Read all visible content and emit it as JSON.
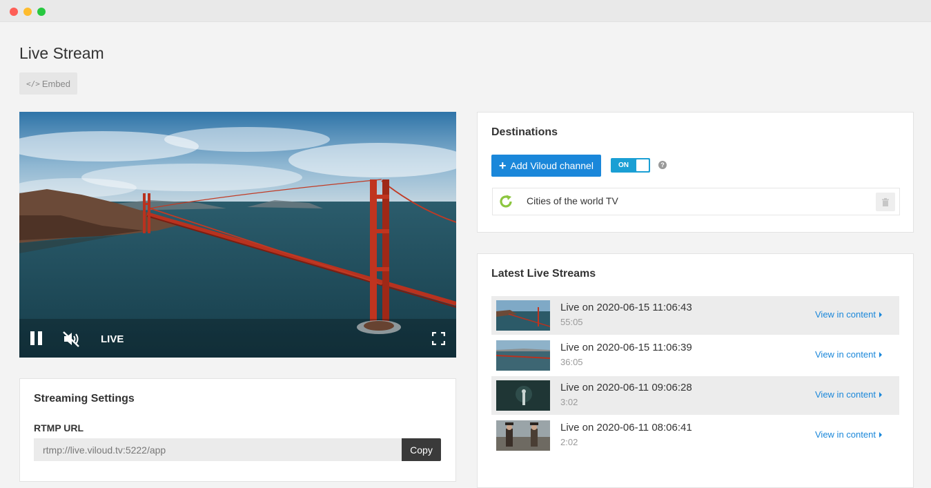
{
  "page": {
    "title": "Live Stream",
    "embed_label": "Embed"
  },
  "player": {
    "live_label": "LIVE",
    "state": "playing",
    "muted": true
  },
  "streaming_settings": {
    "title": "Streaming Settings",
    "rtmp_label": "RTMP URL",
    "rtmp_value": "rtmp://live.viloud.tv:5222/app",
    "copy_label": "Copy"
  },
  "destinations": {
    "title": "Destinations",
    "add_label": "Add Viloud channel",
    "toggle_label": "ON",
    "help_symbol": "?",
    "channels": [
      {
        "name": "Cities of the world TV"
      }
    ]
  },
  "latest": {
    "title": "Latest Live Streams",
    "link_label": "View in content",
    "items": [
      {
        "title": "Live on 2020-06-15 11:06:43",
        "duration": "55:05"
      },
      {
        "title": "Live on 2020-06-15 11:06:39",
        "duration": "36:05"
      },
      {
        "title": "Live on 2020-06-11 09:06:28",
        "duration": "3:02"
      },
      {
        "title": "Live on 2020-06-11 08:06:41",
        "duration": "2:02"
      }
    ]
  },
  "colors": {
    "accent": "#1a87da",
    "toggle": "#1a9fd4",
    "refresh": "#8cc63f"
  },
  "icons": [
    "code-icon",
    "pause-icon",
    "mute-icon",
    "fullscreen-icon",
    "plus-icon",
    "help-icon",
    "refresh-icon",
    "trash-icon",
    "caret-right-icon"
  ]
}
